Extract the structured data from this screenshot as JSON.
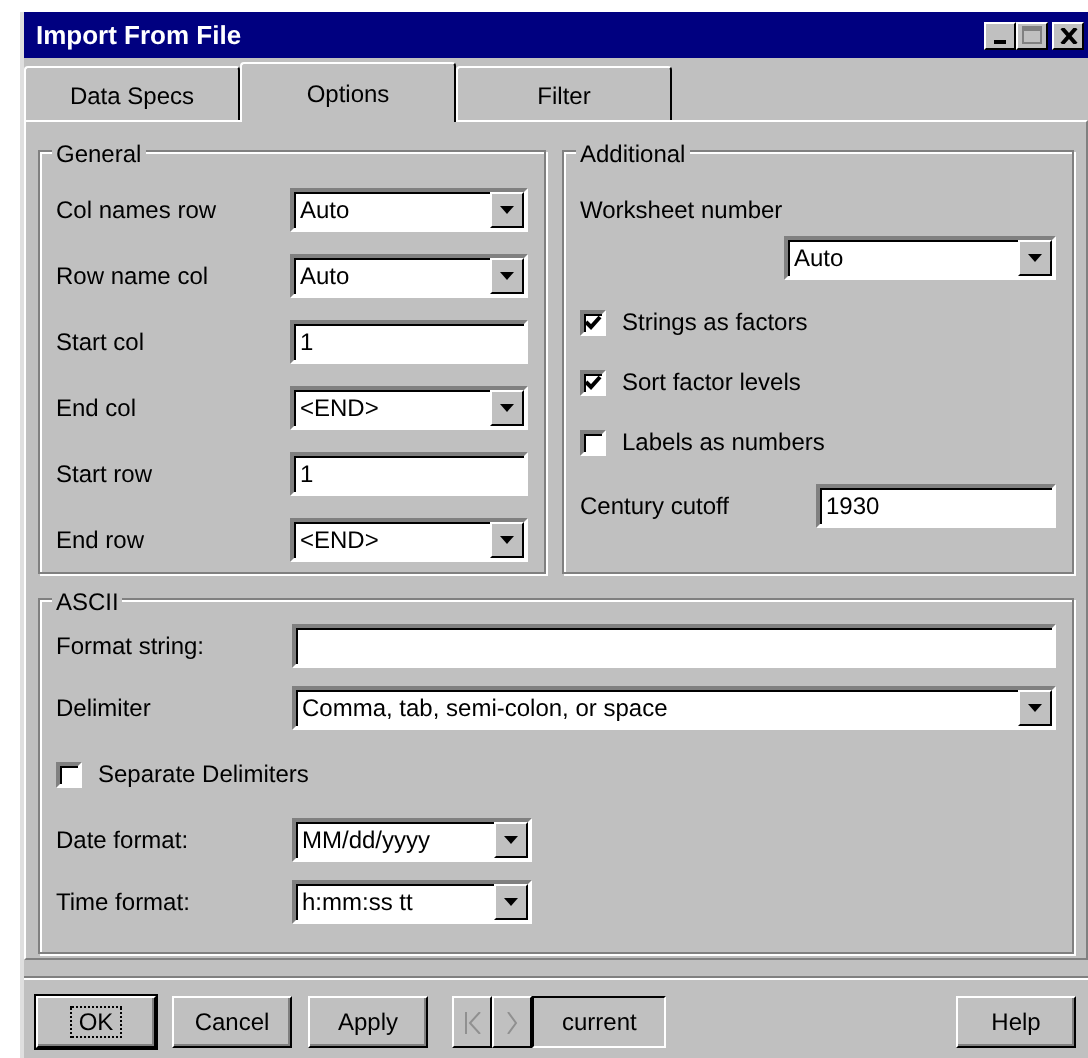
{
  "window": {
    "title": "Import From File"
  },
  "tabs": [
    {
      "label": "Data Specs",
      "selected": false
    },
    {
      "label": "Options",
      "selected": true
    },
    {
      "label": "Filter",
      "selected": false
    }
  ],
  "general": {
    "title": "General",
    "fields": [
      {
        "kind": "combo",
        "label": "Col names row",
        "value": "Auto"
      },
      {
        "kind": "combo",
        "label": "Row name col",
        "value": "Auto"
      },
      {
        "kind": "text",
        "label": "Start col",
        "value": "1"
      },
      {
        "kind": "combo",
        "label": "End col",
        "value": "<END>"
      },
      {
        "kind": "text",
        "label": "Start row",
        "value": "1"
      },
      {
        "kind": "combo",
        "label": "End row",
        "value": "<END>"
      }
    ]
  },
  "additional": {
    "title": "Additional",
    "items": [
      {
        "kind": "combo-below",
        "label": "Worksheet number",
        "value": "Auto"
      },
      {
        "kind": "checkbox",
        "label": "Strings as factors",
        "checked": true
      },
      {
        "kind": "checkbox",
        "label": "Sort factor levels",
        "checked": true
      },
      {
        "kind": "checkbox",
        "label": "Labels as numbers",
        "checked": false
      },
      {
        "kind": "text",
        "label": "Century cutoff",
        "value": "1930"
      }
    ]
  },
  "ascii": {
    "title": "ASCII",
    "items": [
      {
        "kind": "text",
        "label": "Format string:"
      },
      {
        "kind": "combo",
        "label": "Delimiter",
        "value": "Comma, tab, semi-colon, or space"
      },
      {
        "kind": "checkbox",
        "label": "Separate Delimiters",
        "checked": false
      },
      {
        "kind": "combo-short",
        "label": "Date format:",
        "value": "MM/dd/yyyy"
      },
      {
        "kind": "combo-short",
        "label": "Time format:",
        "value": "h:mm:ss tt"
      }
    ]
  },
  "buttons": [
    {
      "label": "OK",
      "default": true
    },
    {
      "label": "Cancel",
      "default": false
    },
    {
      "label": "Apply",
      "default": false
    }
  ],
  "navigator": {
    "first_disabled": true,
    "next_disabled": true,
    "value": "current"
  },
  "help_button": {
    "label": "Help"
  }
}
